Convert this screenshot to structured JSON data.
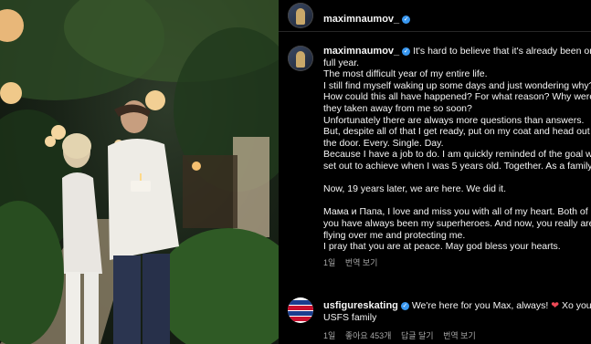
{
  "header": {
    "username": "maximnaumov_",
    "verified_icon": "verified-badge-icon"
  },
  "post": {
    "username": "maximnaumov_",
    "lines": [
      "It's hard to believe that it's already been one",
      "full year.",
      "The most difficult year of my entire life.",
      "I still find myself waking up some days and just wondering why?",
      "How could this all have happened? For what reason? Why were",
      "they taken away from me so soon?",
      "Unfortunately there are always more questions than answers.",
      "But, despite all of that I get ready, put on my coat and head out",
      "the door. Every. Single. Day.",
      "Because I have a job to do. I am quickly reminded of the goal we",
      "set out to achieve when I was 5 years old. Together. As a family.",
      "",
      "Now, 19 years later, we are here. We did it.",
      "",
      "Мама и Папа, I love and miss you with all of my heart. Both of",
      "you have always been my superheroes. And now, you really are",
      "flying over me and protecting me.",
      "I pray that you are at peace. May god bless your hearts."
    ],
    "time": "1일",
    "translate": "번역 보기"
  },
  "comment": {
    "username": "usfigureskating",
    "text_line1": "We're here for you Max, always!",
    "heart": "❤",
    "text_line1_end": "Xo your",
    "text_line2": "USFS family",
    "time": "1일",
    "likes": "좋아요 453개",
    "reply": "답글 달기",
    "translate": "번역 보기"
  },
  "colors": {
    "background": "#000000",
    "text": "#f5f5f5",
    "secondary": "#a8a8a8",
    "verified": "#3897f0",
    "heart": "#ed4956"
  }
}
